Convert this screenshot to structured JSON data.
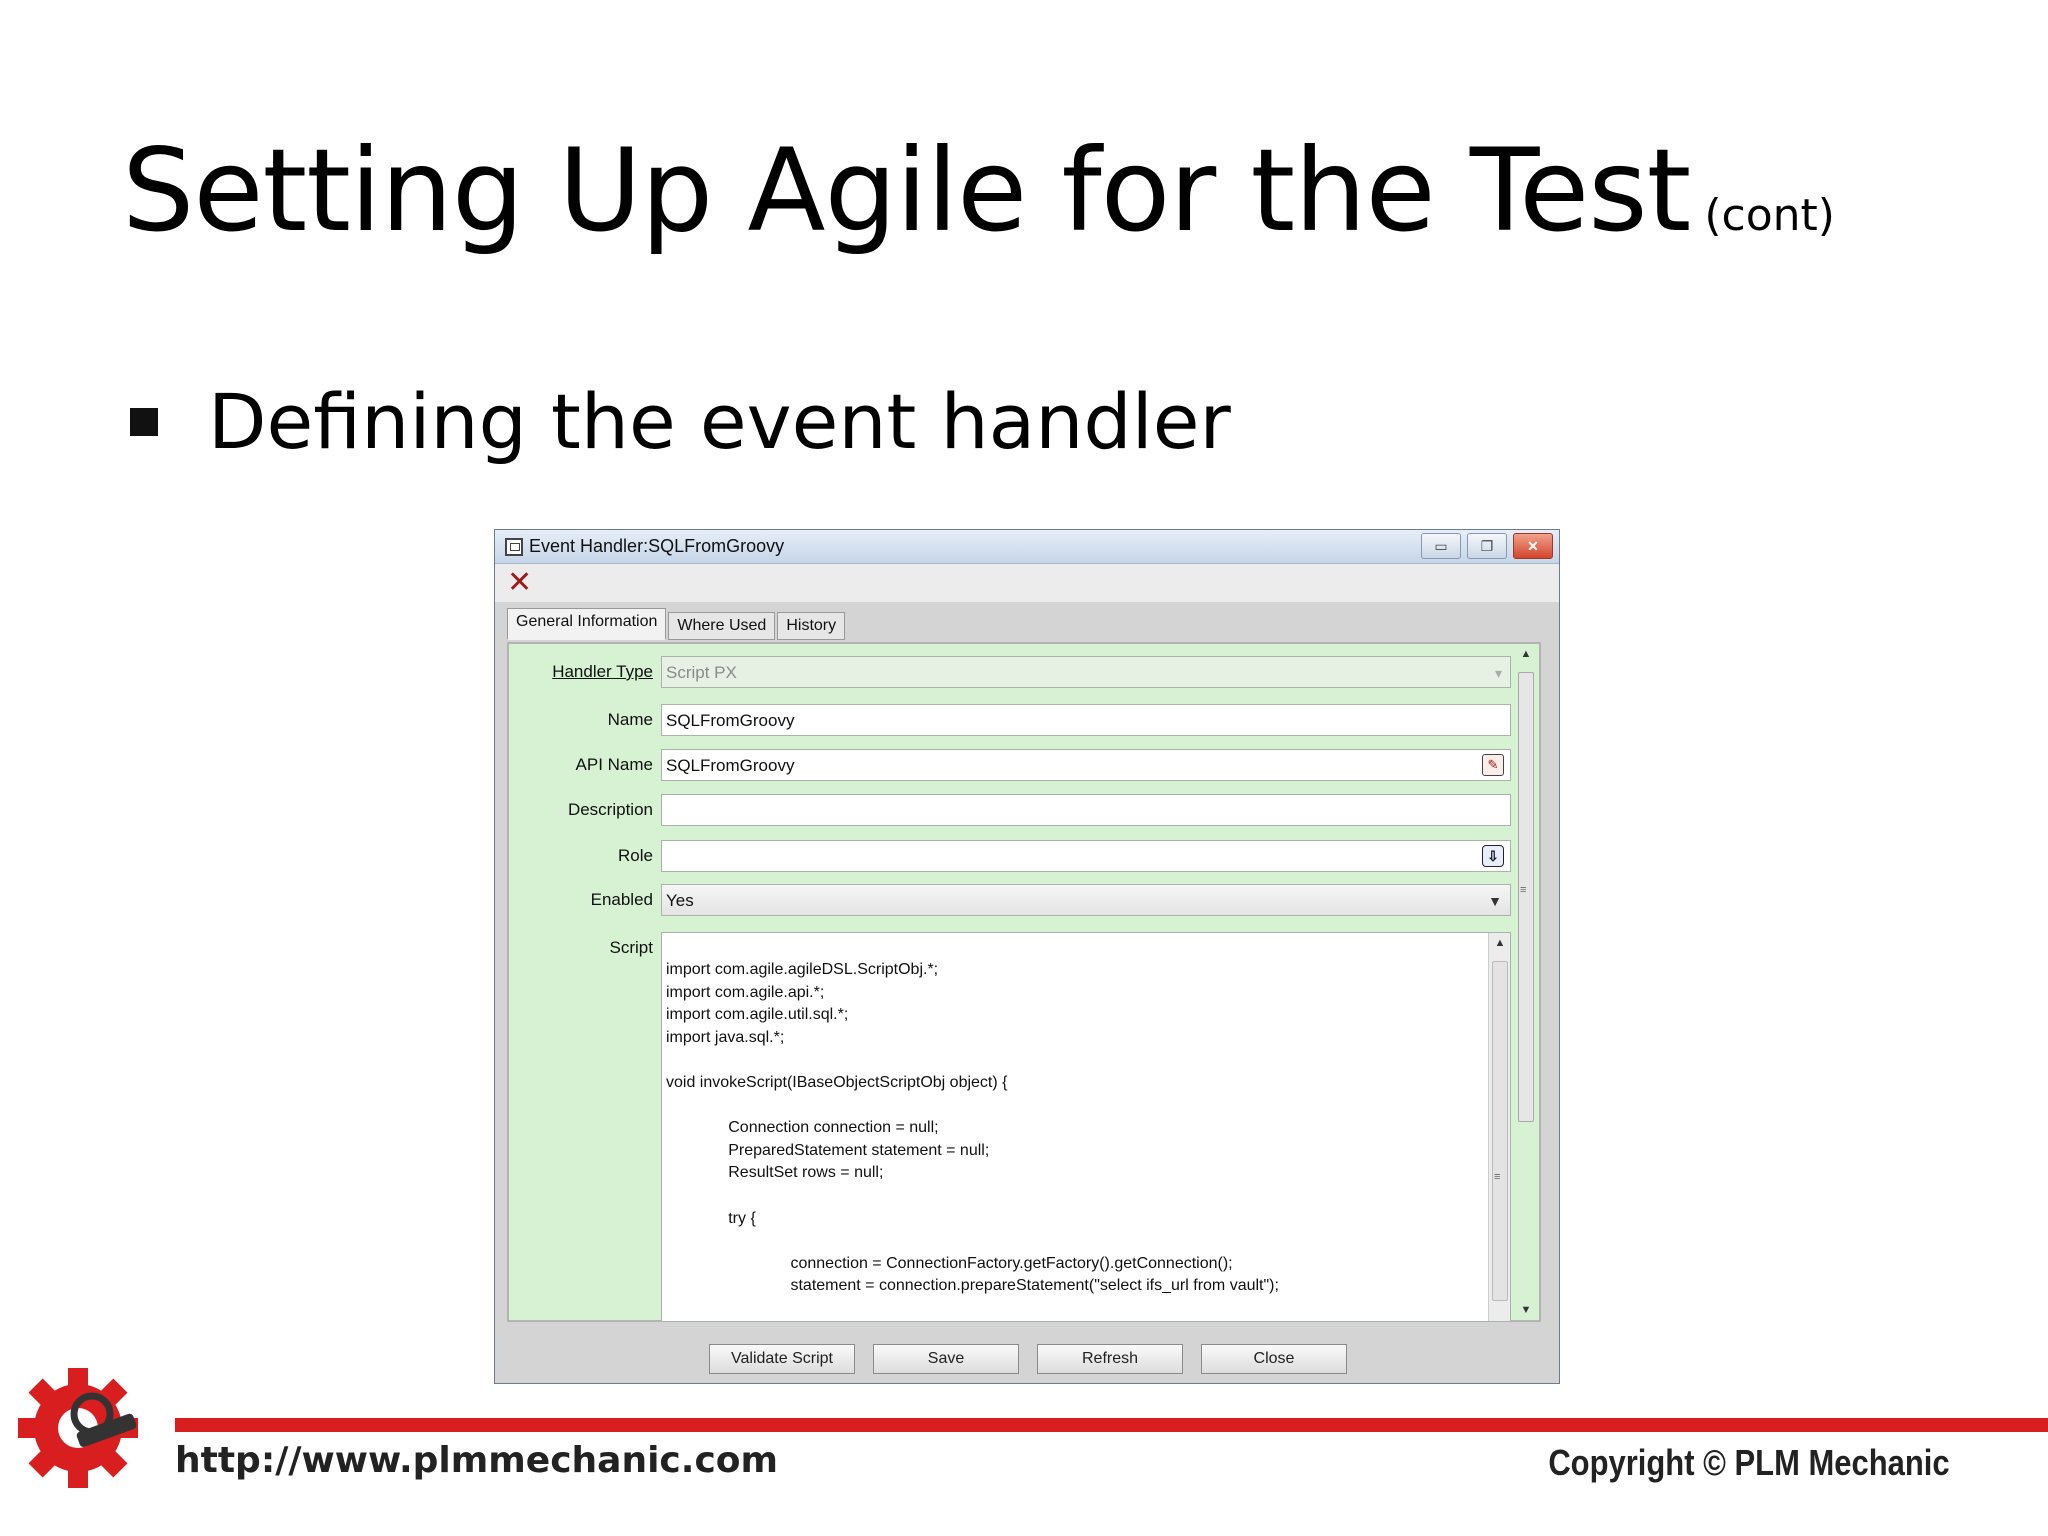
{
  "slide": {
    "title": "Setting Up Agile for the Test",
    "title_suffix": "(cont)",
    "bullet": "Defining the event handler"
  },
  "window": {
    "title": "Event Handler:SQLFromGroovy",
    "tabs": [
      "General Information",
      "Where Used",
      "History"
    ],
    "fields": {
      "handler_type": {
        "label": "Handler Type",
        "value": "Script PX"
      },
      "name": {
        "label": "Name",
        "value": "SQLFromGroovy"
      },
      "api_name": {
        "label": "API Name",
        "value": "SQLFromGroovy"
      },
      "description": {
        "label": "Description",
        "value": ""
      },
      "role": {
        "label": "Role",
        "value": ""
      },
      "enabled": {
        "label": "Enabled",
        "value": "Yes"
      },
      "script": {
        "label": "Script"
      }
    },
    "script_lines": [
      "import com.agile.agileDSL.ScriptObj.*;",
      "import com.agile.api.*;",
      "import com.agile.util.sql.*;",
      "import java.sql.*;",
      "",
      "void invokeScript(IBaseObjectScriptObj object) {",
      "",
      "              Connection connection = null;",
      "              PreparedStatement statement = null;",
      "              ResultSet rows = null;",
      "",
      "              try {",
      "",
      "                            connection = ConnectionFactory.getFactory().getConnection();",
      "                            statement = connection.prepareStatement(\"select ifs_url from vault\");"
    ],
    "buttons": {
      "validate": "Validate Script",
      "save": "Save",
      "refresh": "Refresh",
      "close": "Close"
    }
  },
  "footer": {
    "url": "http://www.plmmechanic.com",
    "copyright": "Copyright © PLM Mechanic"
  },
  "colors": {
    "panel_bg": "#d7f2d3",
    "footer_line": "#d81e1e"
  }
}
